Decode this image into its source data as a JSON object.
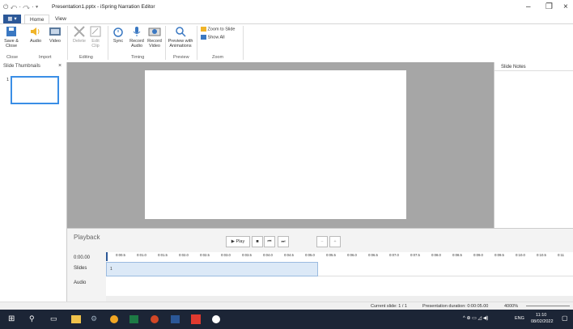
{
  "window": {
    "title": "Presentation1.pptx - iSpring Narration Editor",
    "quick_access": "⏻ ↶ · ↷ · ▾"
  },
  "ribbon": {
    "tabs": [
      "Home",
      "View"
    ],
    "file_tab": "▦ ▾",
    "buttons": {
      "save_close": "Save &\nClose",
      "audio": "Audio",
      "video": "Video",
      "delete": "Delete",
      "edit_clip": "Edit\nClip",
      "sync": "Sync",
      "record_audio": "Record\nAudio",
      "record_video": "Record\nVideo",
      "preview": "Preview with\nAnimations",
      "zoom_to_slide": "Zoom to Slide",
      "show_all": "Show All"
    },
    "groups": [
      "Close",
      "Import",
      "Editing",
      "Timing",
      "Preview",
      "Zoom"
    ]
  },
  "panels": {
    "thumbnails_title": "Slide Thumbnails",
    "thumbnail_number": "1",
    "notes_title": "Slide Notes"
  },
  "playback": {
    "title": "Playback",
    "play_label": "▶ Play",
    "time": "0:00.00",
    "row_slides": "Slides",
    "row_audio": "Audio",
    "slide_clip_label": "1",
    "ticks": [
      "0:00.5",
      "0:01.0",
      "0:01.5",
      "0:02.0",
      "0:02.5",
      "0:03.0",
      "0:03.5",
      "0:04.0",
      "0:04.5",
      "0:05.0",
      "0:05.5",
      "0:06.0",
      "0:06.5",
      "0:07.0",
      "0:07.5",
      "0:08.0",
      "0:08.5",
      "0:09.0",
      "0:09.5",
      "0:10.0",
      "0:10.5",
      "0:11"
    ]
  },
  "status": {
    "current_slide": "Current slide: 1 / 1",
    "duration": "Presentation duration: 0:00:05.00",
    "zoom": "4000%"
  },
  "taskbar": {
    "lang": "ENG",
    "time": "11:10",
    "date": "08/02/2022"
  },
  "colors": {
    "accent": "#2b5797",
    "clip": "#dce9f7",
    "stage": "#a6a6a6"
  }
}
